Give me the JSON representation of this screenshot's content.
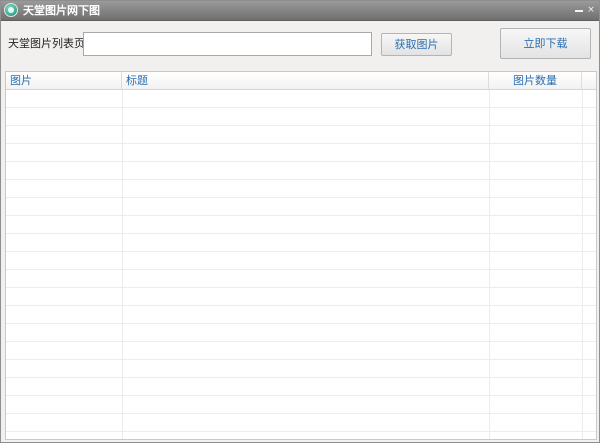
{
  "window": {
    "title": "天堂图片网下图"
  },
  "form": {
    "url_label": "天堂图片列表页：",
    "url_value": "",
    "fetch_label": "获取图片",
    "download_label": "立即下载"
  },
  "table": {
    "columns": [
      "图片",
      "标题",
      "图片数量"
    ],
    "rows": []
  },
  "icons": {
    "app": "app-logo-icon",
    "minimize": "minimize-icon",
    "close": "close-icon"
  },
  "colors": {
    "titlebar": "#7d7d7d",
    "link_text": "#2a6fb0",
    "background": "#f1f0ee"
  }
}
